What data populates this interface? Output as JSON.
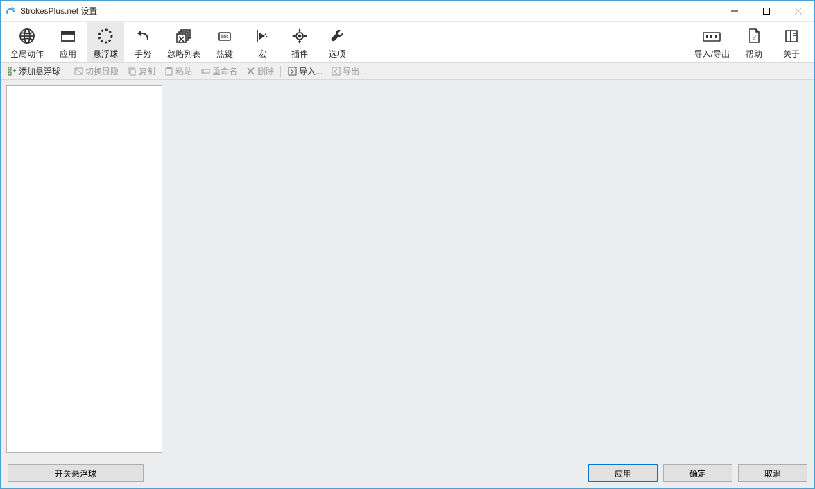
{
  "window": {
    "title": "StrokesPlus.net 设置"
  },
  "toolbar": {
    "items": [
      {
        "label": "全局动作"
      },
      {
        "label": "应用"
      },
      {
        "label": "悬浮球"
      },
      {
        "label": "手势"
      },
      {
        "label": "忽略列表"
      },
      {
        "label": "热键"
      },
      {
        "label": "宏"
      },
      {
        "label": "插件"
      },
      {
        "label": "选项"
      }
    ],
    "right": [
      {
        "label": "导入/导出"
      },
      {
        "label": "帮助"
      },
      {
        "label": "关于"
      }
    ]
  },
  "actionbar": {
    "add": "添加悬浮球",
    "toggle": "切换显隐",
    "copy": "复制",
    "paste": "粘贴",
    "rename": "重命名",
    "delete": "删除",
    "import": "导入...",
    "export": "导出..."
  },
  "footer": {
    "toggle_floater": "开关悬浮球",
    "apply": "应用",
    "ok": "确定",
    "cancel": "取消"
  }
}
